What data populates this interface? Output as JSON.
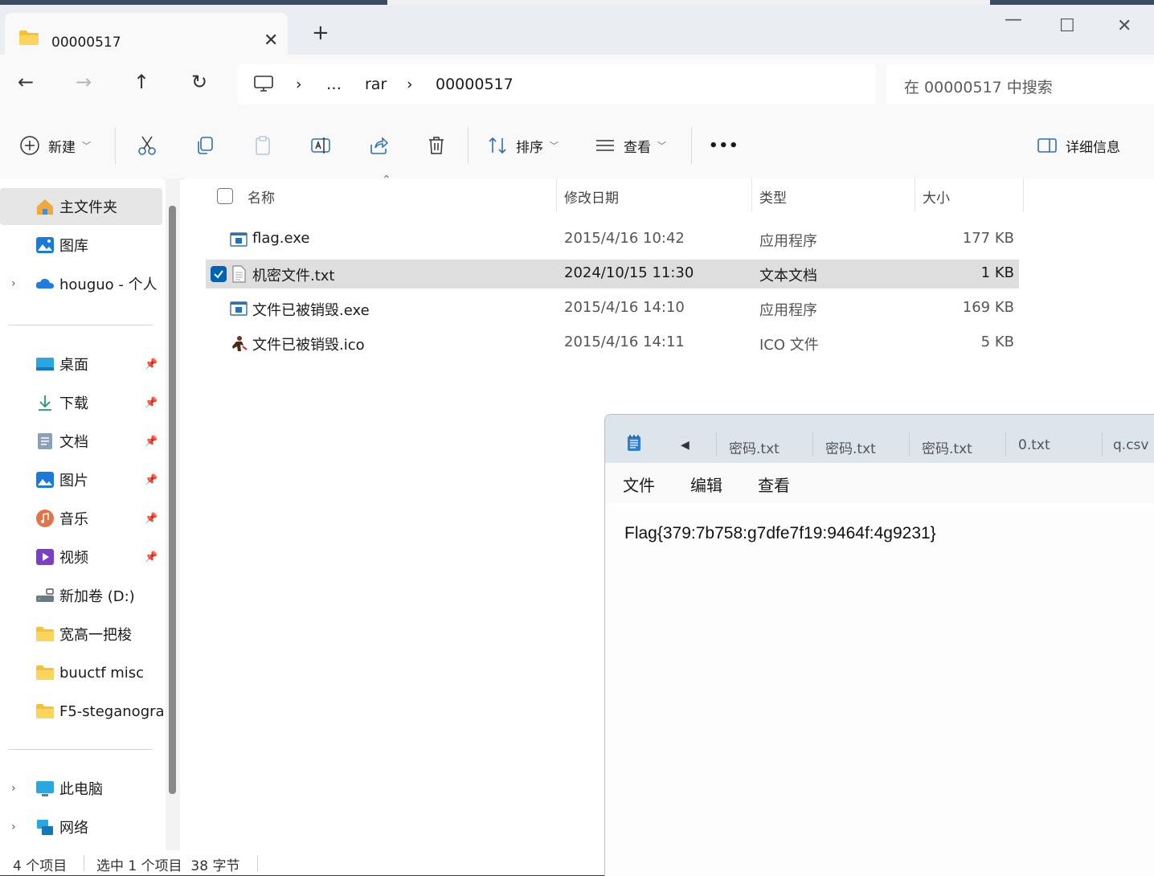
{
  "tab": {
    "title": "00000517"
  },
  "address": {
    "crumbs": [
      "…",
      "rar",
      "00000517"
    ],
    "search_placeholder": "在 00000517 中搜索"
  },
  "toolbar": {
    "new_label": "新建",
    "sort_label": "排序",
    "view_label": "查看",
    "more_label": "•••",
    "details_label": "详细信息"
  },
  "sidebar": {
    "top": [
      {
        "label": "主文件夹",
        "icon": "home-icon"
      },
      {
        "label": "图库",
        "icon": "gallery-icon"
      },
      {
        "label": "houguo - 个人",
        "icon": "cloud-icon"
      }
    ],
    "pinned": [
      {
        "label": "桌面",
        "icon": "desktop-icon"
      },
      {
        "label": "下载",
        "icon": "download-icon"
      },
      {
        "label": "文档",
        "icon": "documents-icon"
      },
      {
        "label": "图片",
        "icon": "pictures-icon"
      },
      {
        "label": "音乐",
        "icon": "music-icon"
      },
      {
        "label": "视频",
        "icon": "videos-icon"
      }
    ],
    "folders": [
      {
        "label": "新加卷 (D:)",
        "icon": "drive-icon"
      },
      {
        "label": "宽高一把梭",
        "icon": "folder-icon"
      },
      {
        "label": "buuctf misc",
        "icon": "folder-icon"
      },
      {
        "label": "F5-steganogra",
        "icon": "folder-icon"
      }
    ],
    "bottom": [
      {
        "label": "此电脑",
        "icon": "computer-icon"
      },
      {
        "label": "网络",
        "icon": "network-icon"
      }
    ]
  },
  "columns": {
    "name": "名称",
    "date": "修改日期",
    "type": "类型",
    "size": "大小"
  },
  "files": [
    {
      "name": "flag.exe",
      "date": "2015/4/16 10:42",
      "type": "应用程序",
      "size": "177 KB",
      "icon": "exe-icon"
    },
    {
      "name": "机密文件.txt",
      "date": "2024/10/15 11:30",
      "type": "文本文档",
      "size": "1 KB",
      "icon": "txt-icon",
      "selected": true
    },
    {
      "name": "文件已被销毁.exe",
      "date": "2015/4/16 14:10",
      "type": "应用程序",
      "size": "169 KB",
      "icon": "exe-icon"
    },
    {
      "name": "文件已被销毁.ico",
      "date": "2015/4/16 14:11",
      "type": "ICO 文件",
      "size": "5 KB",
      "icon": "ico-icon"
    }
  ],
  "status": {
    "count": "4 个项目",
    "selection": "选中 1 个项目  38 字节"
  },
  "notepad": {
    "tabs": [
      "密码.txt",
      "密码.txt",
      "密码.txt",
      "0.txt",
      "q.csv"
    ],
    "menu": [
      "文件",
      "编辑",
      "查看"
    ],
    "content": "Flag{379:7b758:g7dfe7f19:9464f:4g9231}"
  },
  "colors": {
    "accent": "#0063b1",
    "selected_row": "#dedede",
    "tabbar": "#eaeef3"
  }
}
